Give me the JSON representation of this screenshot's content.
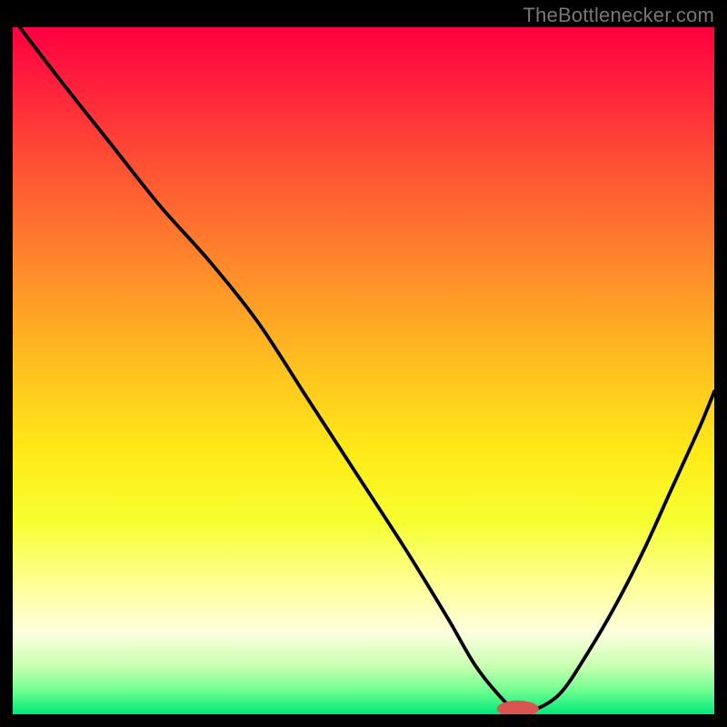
{
  "watermark": "TheBottlenecker.com",
  "chart_data": {
    "type": "line",
    "title": "",
    "xlabel": "",
    "ylabel": "",
    "xlim": [
      0,
      100
    ],
    "ylim": [
      0,
      100
    ],
    "gradient_stops": [
      {
        "offset": 0,
        "color": "#ff0040"
      },
      {
        "offset": 0.08,
        "color": "#ff1f3c"
      },
      {
        "offset": 0.2,
        "color": "#ff5034"
      },
      {
        "offset": 0.35,
        "color": "#ff8a2a"
      },
      {
        "offset": 0.5,
        "color": "#ffc31f"
      },
      {
        "offset": 0.62,
        "color": "#ffea18"
      },
      {
        "offset": 0.72,
        "color": "#f6ff30"
      },
      {
        "offset": 0.82,
        "color": "#ffffa0"
      },
      {
        "offset": 0.88,
        "color": "#ffffe0"
      },
      {
        "offset": 0.93,
        "color": "#c8ffb0"
      },
      {
        "offset": 0.965,
        "color": "#70ff90"
      },
      {
        "offset": 1.0,
        "color": "#00e878"
      }
    ],
    "curve": {
      "x": [
        1,
        7,
        14,
        21,
        28,
        35,
        42,
        49,
        56,
        62,
        66,
        70,
        72,
        74,
        78,
        82,
        86,
        90,
        94,
        98,
        100
      ],
      "y": [
        100,
        92,
        83,
        74,
        66,
        57,
        46,
        35,
        24,
        14,
        7,
        2,
        0.5,
        0.5,
        3,
        9,
        16,
        24,
        33,
        42,
        47
      ]
    },
    "flat_zone": {
      "x_start": 70,
      "x_end": 74,
      "y": 0.5
    },
    "marker": {
      "x": 72,
      "y": 0.8,
      "color": "#d9544f",
      "rx": 3.0,
      "ry": 1.2
    }
  }
}
